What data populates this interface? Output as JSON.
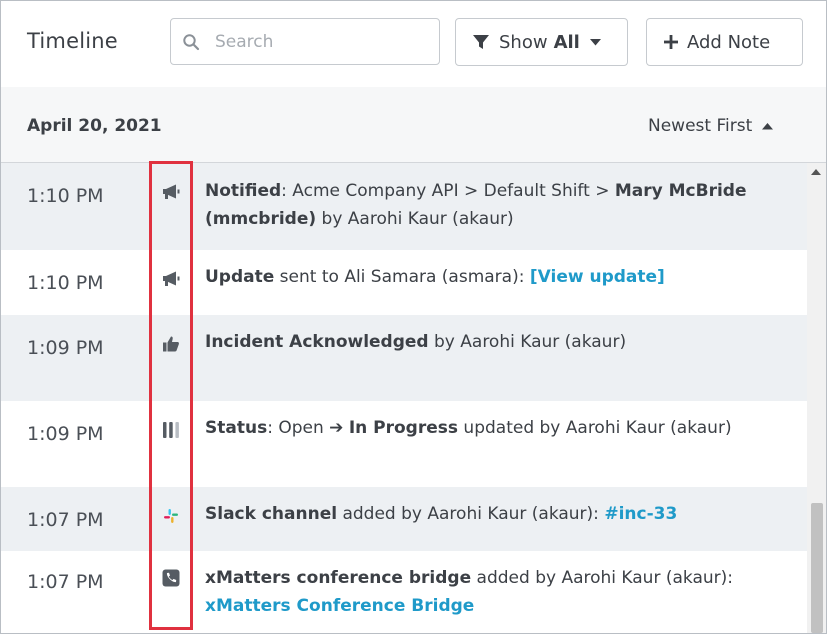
{
  "header": {
    "title": "Timeline",
    "search_placeholder": "Search",
    "show_label": "Show",
    "show_value": "All",
    "add_note_label": "Add Note"
  },
  "date_bar": {
    "date": "April 20, 2021",
    "sort_label": "Newest First"
  },
  "rows": [
    {
      "time": "1:10 PM",
      "icon": "megaphone-icon",
      "parts": [
        {
          "t": "Notified",
          "b": true
        },
        {
          "t": ": Acme Company API > Default Shift > "
        },
        {
          "t": "Mary McBride (mmcbride)",
          "b": true
        },
        {
          "t": " by Aarohi Kaur (akaur)"
        }
      ]
    },
    {
      "time": "1:10 PM",
      "icon": "megaphone-icon",
      "parts": [
        {
          "t": "Update",
          "b": true
        },
        {
          "t": " sent to Ali Samara (asmara): "
        },
        {
          "t": "[View update]",
          "link": true
        }
      ]
    },
    {
      "time": "1:09 PM",
      "icon": "thumbs-up-icon",
      "parts": [
        {
          "t": "Incident Acknowledged",
          "b": true
        },
        {
          "t": " by Aarohi Kaur (akaur)"
        }
      ]
    },
    {
      "time": "1:09 PM",
      "icon": "status-bars-icon",
      "parts": [
        {
          "t": "Status",
          "b": true
        },
        {
          "t": ": Open "
        },
        {
          "t": "➔",
          "b": true
        },
        {
          "t": " "
        },
        {
          "t": "In Progress",
          "b": true
        },
        {
          "t": " updated by Aarohi Kaur (akaur)"
        }
      ]
    },
    {
      "time": "1:07 PM",
      "icon": "slack-icon",
      "parts": [
        {
          "t": "Slack channel",
          "b": true
        },
        {
          "t": " added by Aarohi Kaur (akaur): "
        },
        {
          "t": "#inc-33",
          "link": true
        }
      ]
    },
    {
      "time": "1:07 PM",
      "icon": "phone-icon",
      "parts": [
        {
          "t": "xMatters conference bridge",
          "b": true
        },
        {
          "t": " added by Aarohi Kaur (akaur): "
        },
        {
          "t": "xMatters Conference Bridge",
          "link": true
        }
      ]
    }
  ],
  "colors": {
    "link": "#1f9ac9",
    "shaded_row": "#edf0f3",
    "highlight": "#e0313f"
  }
}
